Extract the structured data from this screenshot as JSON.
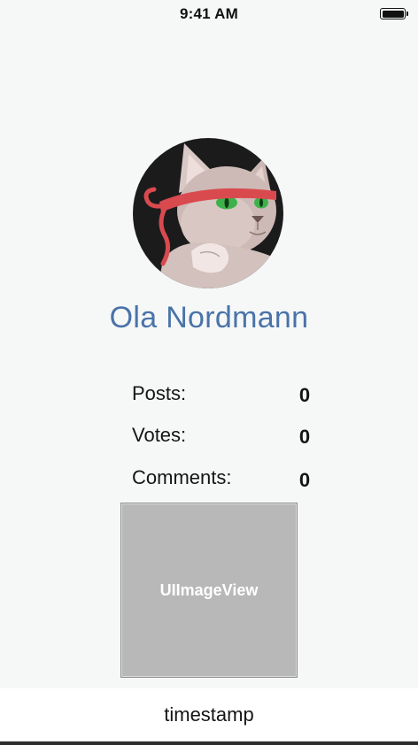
{
  "status_bar": {
    "time": "9:41 AM",
    "battery_icon": "battery-full-icon"
  },
  "profile": {
    "avatar_icon": "cat-avatar-image",
    "name": "Ola Nordmann",
    "name_color": "#4a73a8"
  },
  "stats": [
    {
      "label": "Posts:",
      "value": "0"
    },
    {
      "label": "Votes:",
      "value": "0"
    },
    {
      "label": "Comments:",
      "value": "0"
    }
  ],
  "image_view": {
    "label": "UIImageView",
    "fill_color": "#b8b8b8"
  },
  "footer": {
    "timestamp": "timestamp"
  }
}
